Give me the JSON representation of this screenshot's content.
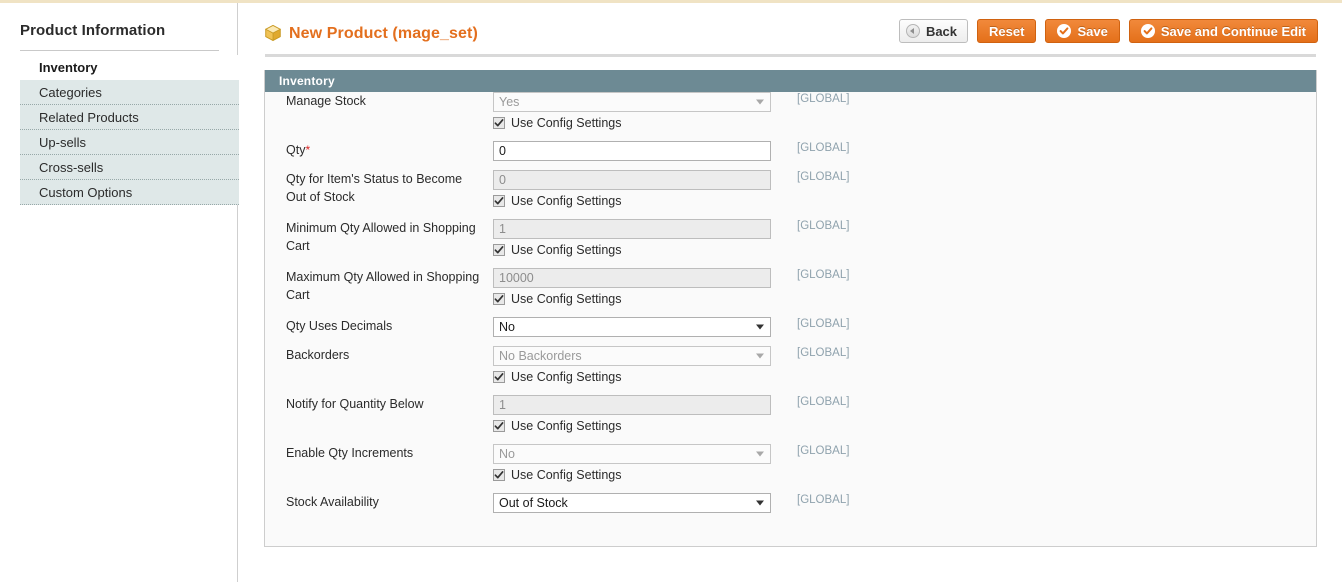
{
  "sidebar": {
    "title": "Product Information",
    "items": [
      {
        "label": "Inventory",
        "active": true
      },
      {
        "label": "Categories",
        "active": false
      },
      {
        "label": "Related Products",
        "active": false
      },
      {
        "label": "Up-sells",
        "active": false
      },
      {
        "label": "Cross-sells",
        "active": false
      },
      {
        "label": "Custom Options",
        "active": false
      }
    ]
  },
  "header": {
    "title": "New Product (mage_set)",
    "icon": "product-cube-icon",
    "buttons": {
      "back": "Back",
      "reset": "Reset",
      "save": "Save",
      "save_continue": "Save and Continue Edit"
    }
  },
  "panel": {
    "section_title": "Inventory",
    "use_config_label": "Use Config Settings",
    "scope_label": "[GLOBAL]",
    "rows": [
      {
        "label": "Manage Stock",
        "control": "select",
        "value": "Yes",
        "disabled": true,
        "use_config": true,
        "scope": "[GLOBAL]"
      },
      {
        "label": "Qty",
        "required": true,
        "control": "input",
        "value": "0",
        "disabled": false,
        "use_config": false,
        "scope": "[GLOBAL]"
      },
      {
        "label": "Qty for Item's Status to Become Out of Stock",
        "control": "input",
        "value": "0",
        "disabled": true,
        "use_config": true,
        "scope": "[GLOBAL]"
      },
      {
        "label": "Minimum Qty Allowed in Shopping Cart",
        "control": "input",
        "value": "1",
        "disabled": true,
        "use_config": true,
        "scope": "[GLOBAL]"
      },
      {
        "label": "Maximum Qty Allowed in Shopping Cart",
        "control": "input",
        "value": "10000",
        "disabled": true,
        "use_config": true,
        "scope": "[GLOBAL]"
      },
      {
        "label": "Qty Uses Decimals",
        "control": "select",
        "value": "No",
        "disabled": false,
        "use_config": false,
        "scope": "[GLOBAL]"
      },
      {
        "label": "Backorders",
        "control": "select",
        "value": "No Backorders",
        "disabled": true,
        "use_config": true,
        "scope": "[GLOBAL]"
      },
      {
        "label": "Notify for Quantity Below",
        "control": "input",
        "value": "1",
        "disabled": true,
        "use_config": true,
        "scope": "[GLOBAL]"
      },
      {
        "label": "Enable Qty Increments",
        "control": "select",
        "value": "No",
        "disabled": true,
        "use_config": true,
        "scope": "[GLOBAL]"
      },
      {
        "label": "Stock Availability",
        "control": "select",
        "value": "Out of Stock",
        "disabled": false,
        "use_config": false,
        "scope": "[GLOBAL]"
      }
    ]
  },
  "colors": {
    "accent_orange": "#e36f1e",
    "section_header": "#6d8a94",
    "sidebar_item_bg": "#dfe8e8",
    "scope_text": "#8fa2ad"
  }
}
